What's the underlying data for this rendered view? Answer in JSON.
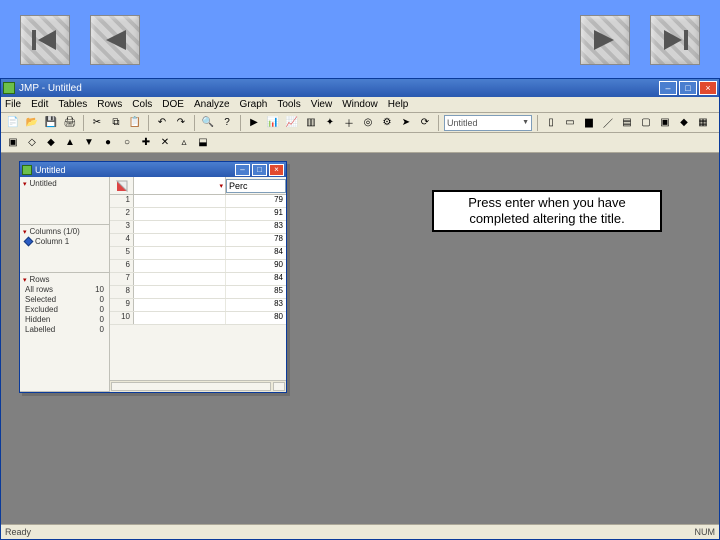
{
  "nav": {
    "first": "first-slide",
    "prev": "previous-slide",
    "next": "next-slide",
    "last": "last-slide"
  },
  "app": {
    "name": "JMP",
    "title": "Untitled",
    "menus": [
      "File",
      "Edit",
      "Tables",
      "Rows",
      "Cols",
      "DOE",
      "Analyze",
      "Graph",
      "Tools",
      "View",
      "Window",
      "Help"
    ],
    "combo_value": "Untitled",
    "status_left": "Ready",
    "status_right": "NUM"
  },
  "child": {
    "title": "Untitled",
    "source_pane": "Untitled",
    "columns_header": "Columns (1/0)",
    "columns": [
      "Column 1"
    ],
    "rows_header": "Rows",
    "rows_stats": [
      {
        "label": "All rows",
        "value": "10"
      },
      {
        "label": "Selected",
        "value": "0"
      },
      {
        "label": "Excluded",
        "value": "0"
      },
      {
        "label": "Hidden",
        "value": "0"
      },
      {
        "label": "Labelled",
        "value": "0"
      }
    ],
    "col_edit_value": "Perc",
    "data": [
      {
        "row": 1,
        "value": 79
      },
      {
        "row": 2,
        "value": 91
      },
      {
        "row": 3,
        "value": 83
      },
      {
        "row": 4,
        "value": 78
      },
      {
        "row": 5,
        "value": 84
      },
      {
        "row": 6,
        "value": 90
      },
      {
        "row": 7,
        "value": 84
      },
      {
        "row": 8,
        "value": 85
      },
      {
        "row": 9,
        "value": 83
      },
      {
        "row": 10,
        "value": 80
      }
    ]
  },
  "callout": {
    "text": "Press enter when you have completed altering the title."
  },
  "icons": [
    "new",
    "open",
    "save",
    "print",
    "sep",
    "cut",
    "copy",
    "paste",
    "sep",
    "undo",
    "redo",
    "sep",
    "find",
    "help",
    "sep",
    "run",
    "chart",
    "fit",
    "dist",
    "graph",
    "tree",
    "plus",
    "star",
    "target",
    "gear",
    "arrow",
    "cycle",
    "sep_combo",
    "sep",
    "col",
    "row",
    "bar",
    "line",
    "hist",
    "box",
    "cell",
    "tag",
    "flag",
    "pin",
    "grid",
    "x"
  ]
}
